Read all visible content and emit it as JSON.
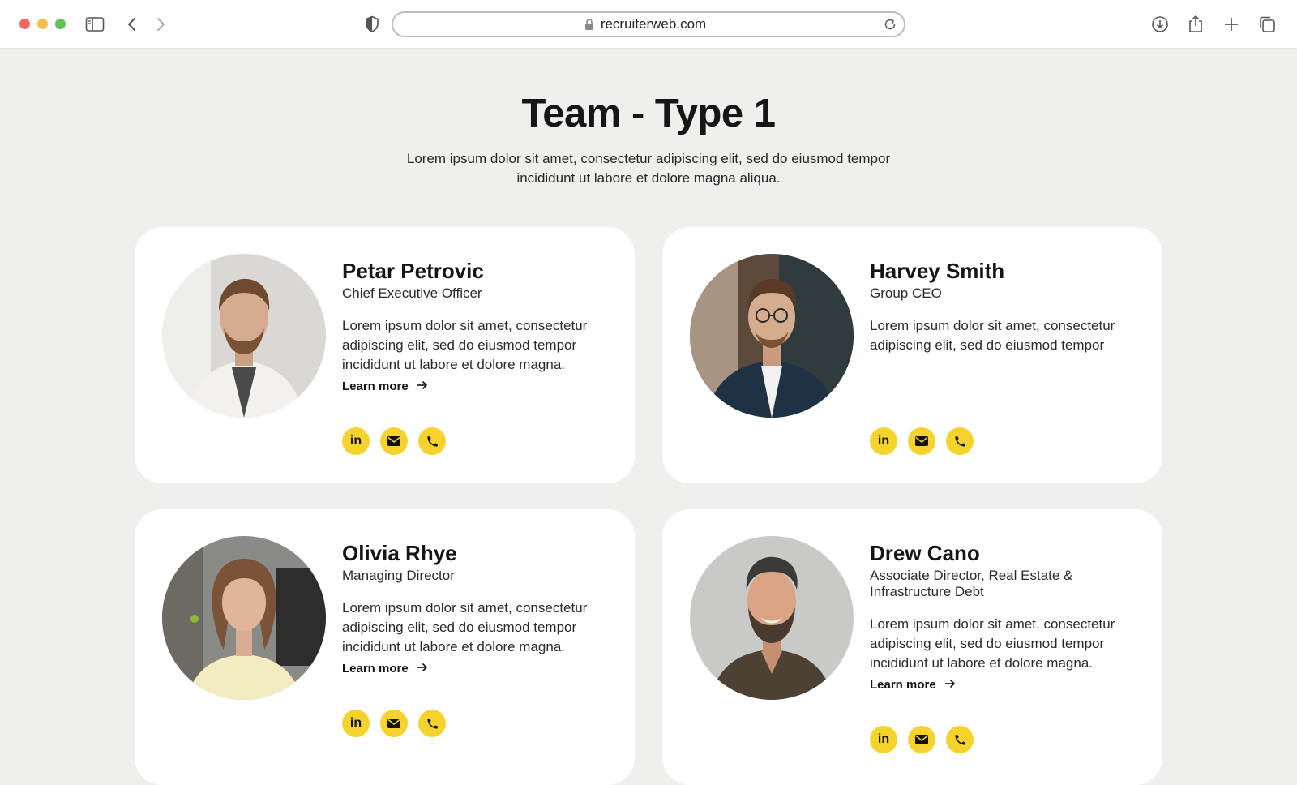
{
  "browser": {
    "url": "recruiterweb.com"
  },
  "page": {
    "title": "Team - Type 1",
    "subtitle": "Lorem ipsum dolor sit amet, consectetur adipiscing elit, sed do eiusmod tempor incididunt ut labore et dolore magna aliqua."
  },
  "colors": {
    "accent": "#f6d22c",
    "background": "#efefed",
    "card": "#ffffff"
  },
  "social_icons": {
    "linkedin_label": "in",
    "email": "envelope-icon",
    "phone": "phone-icon"
  },
  "members": [
    {
      "name": "Petar Petrovic",
      "role": "Chief Executive Officer",
      "bio": "Lorem ipsum dolor sit amet, consectetur adipiscing elit, sed do eiusmod tempor incididunt ut labore et dolore magna.",
      "learn_more": "Learn more"
    },
    {
      "name": "Harvey Smith",
      "role": "Group CEO",
      "bio": "Lorem ipsum dolor sit amet, consectetur adipiscing elit, sed do eiusmod tempor",
      "learn_more": ""
    },
    {
      "name": "Olivia Rhye",
      "role": "Managing Director",
      "bio": "Lorem ipsum dolor sit amet, consectetur adipiscing elit, sed do eiusmod tempor incididunt ut labore et dolore magna.",
      "learn_more": "Learn more"
    },
    {
      "name": "Drew Cano",
      "role": "Associate Director, Real Estate & Infrastructure Debt",
      "bio": "Lorem ipsum dolor sit amet, consectetur adipiscing elit, sed do eiusmod tempor incididunt ut labore et dolore magna.",
      "learn_more": "Learn more"
    }
  ]
}
